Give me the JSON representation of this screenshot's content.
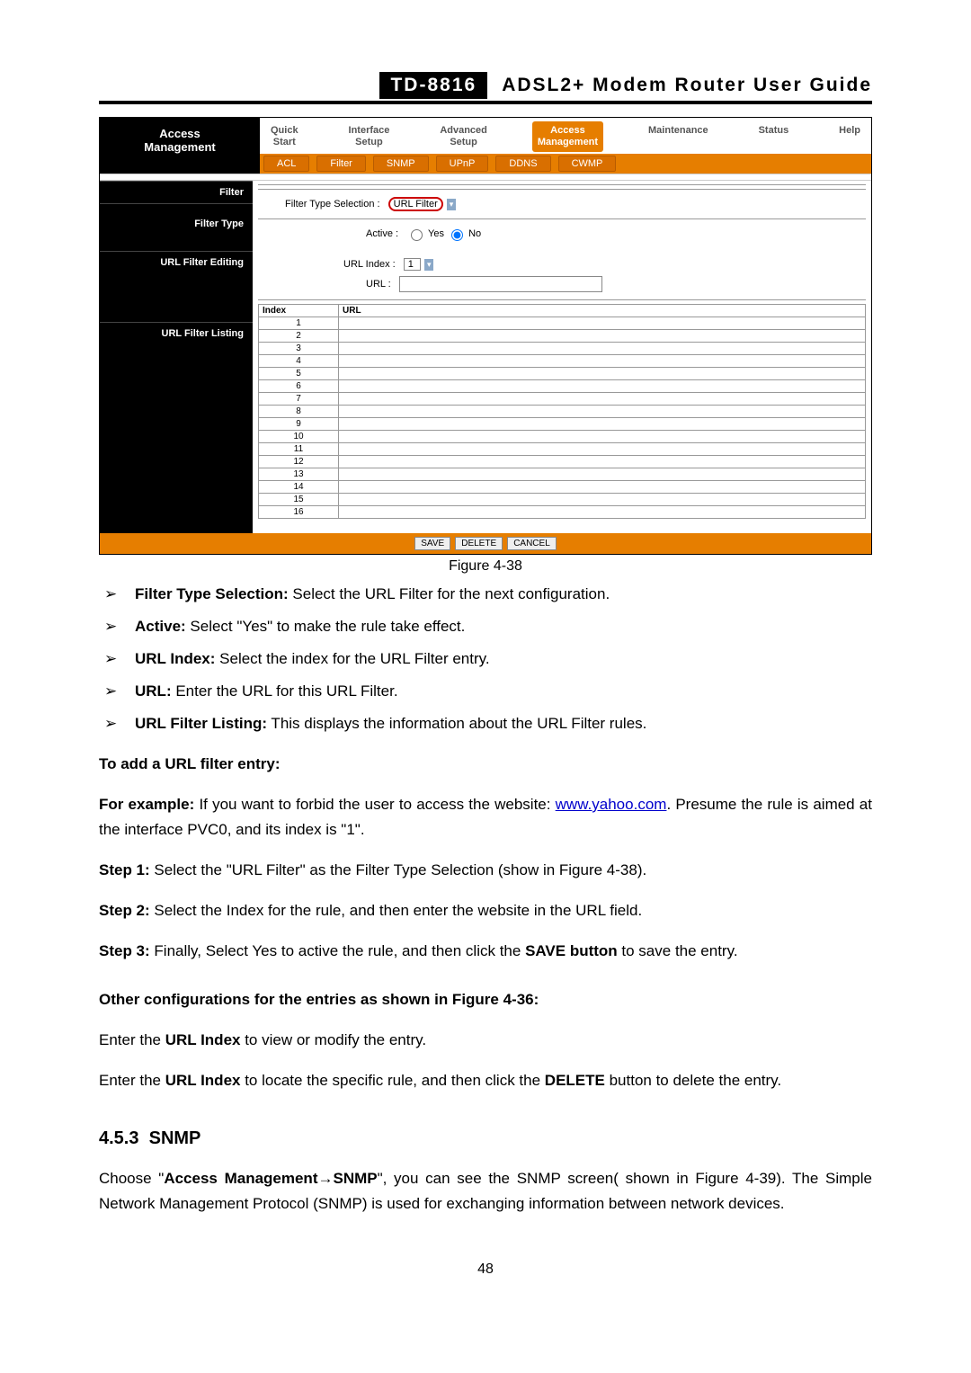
{
  "header": {
    "model": "TD-8816",
    "title": "ADSL2+ Modem Router User Guide"
  },
  "figure": {
    "side_title": "Access\nManagement",
    "top_nav": [
      "Quick\nStart",
      "Interface\nSetup",
      "Advanced\nSetup",
      "Access\nManagement",
      "Maintenance",
      "Status",
      "Help"
    ],
    "top_nav_active_index": 3,
    "sub_nav": [
      "ACL",
      "Filter",
      "SNMP",
      "UPnP",
      "DDNS",
      "CWMP"
    ],
    "sub_nav_circled_index": 1,
    "side_labels": [
      "Filter",
      "Filter Type",
      "URL Filter Editing",
      "URL Filter Listing"
    ],
    "filter_type_label": "Filter Type Selection :",
    "filter_type_value": "URL Filter",
    "active_label": "Active :",
    "active_options": [
      "Yes",
      "No"
    ],
    "active_selected": 1,
    "url_index_label": "URL Index :",
    "url_index_value": "1",
    "url_label": "URL :",
    "url_value": "",
    "listing_headers": [
      "Index",
      "URL"
    ],
    "listing_rows": 16,
    "buttons": [
      "SAVE",
      "DELETE",
      "CANCEL"
    ],
    "caption": "Figure 4-38"
  },
  "bullets": [
    {
      "term": "Filter Type Selection:",
      "desc": " Select the URL Filter for the next configuration."
    },
    {
      "term": "Active:",
      "desc": " Select \"Yes\" to make the rule take effect."
    },
    {
      "term": "URL Index:",
      "desc": " Select the index for the URL Filter entry."
    },
    {
      "term": "URL:",
      "desc": " Enter the URL for this URL Filter."
    },
    {
      "term": "URL Filter Listing:",
      "desc": " This displays the information about the URL Filter rules."
    }
  ],
  "add_heading": "To add a URL filter entry:",
  "for_example_label": "For example:",
  "for_example_text_before_link": " If you want to forbid the user to access the website: ",
  "for_example_link": "www.yahoo.com",
  "for_example_text_after_link": ". Presume the rule is aimed at the interface PVC0, and its index is \"1\".",
  "steps": [
    {
      "label": "Step 1:",
      "text": "  Select the \"URL Filter\" as the Filter Type Selection (show in Figure 4-38)."
    },
    {
      "label": "Step 2:",
      "text": "  Select the Index for the rule, and then enter the website in the URL field."
    },
    {
      "label": "Step 3:",
      "text_before": "  Finally, Select Yes to active the rule, and then click the ",
      "bold": "SAVE button",
      "text_after": " to save the entry."
    }
  ],
  "other_heading": "Other configurations for the entries as shown in Figure 4-36:",
  "other_line1_before": "Enter the ",
  "other_line1_bold": "URL Index",
  "other_line1_after": " to view or modify the entry.",
  "other_line2_before": "Enter the ",
  "other_line2_bold1": "URL Index",
  "other_line2_mid": " to locate the specific rule, and then click the ",
  "other_line2_bold2": "DELETE",
  "other_line2_after": " button to delete the entry.",
  "section_number": "4.5.3",
  "section_title": "SNMP",
  "snmp_para_before": "Choose \"",
  "snmp_para_bold": "Access Management→SNMP",
  "snmp_para_after": "\", you can see the SNMP screen( shown in Figure 4-39). The Simple Network Management Protocol (SNMP) is used for exchanging information between network devices.",
  "page_number": "48"
}
